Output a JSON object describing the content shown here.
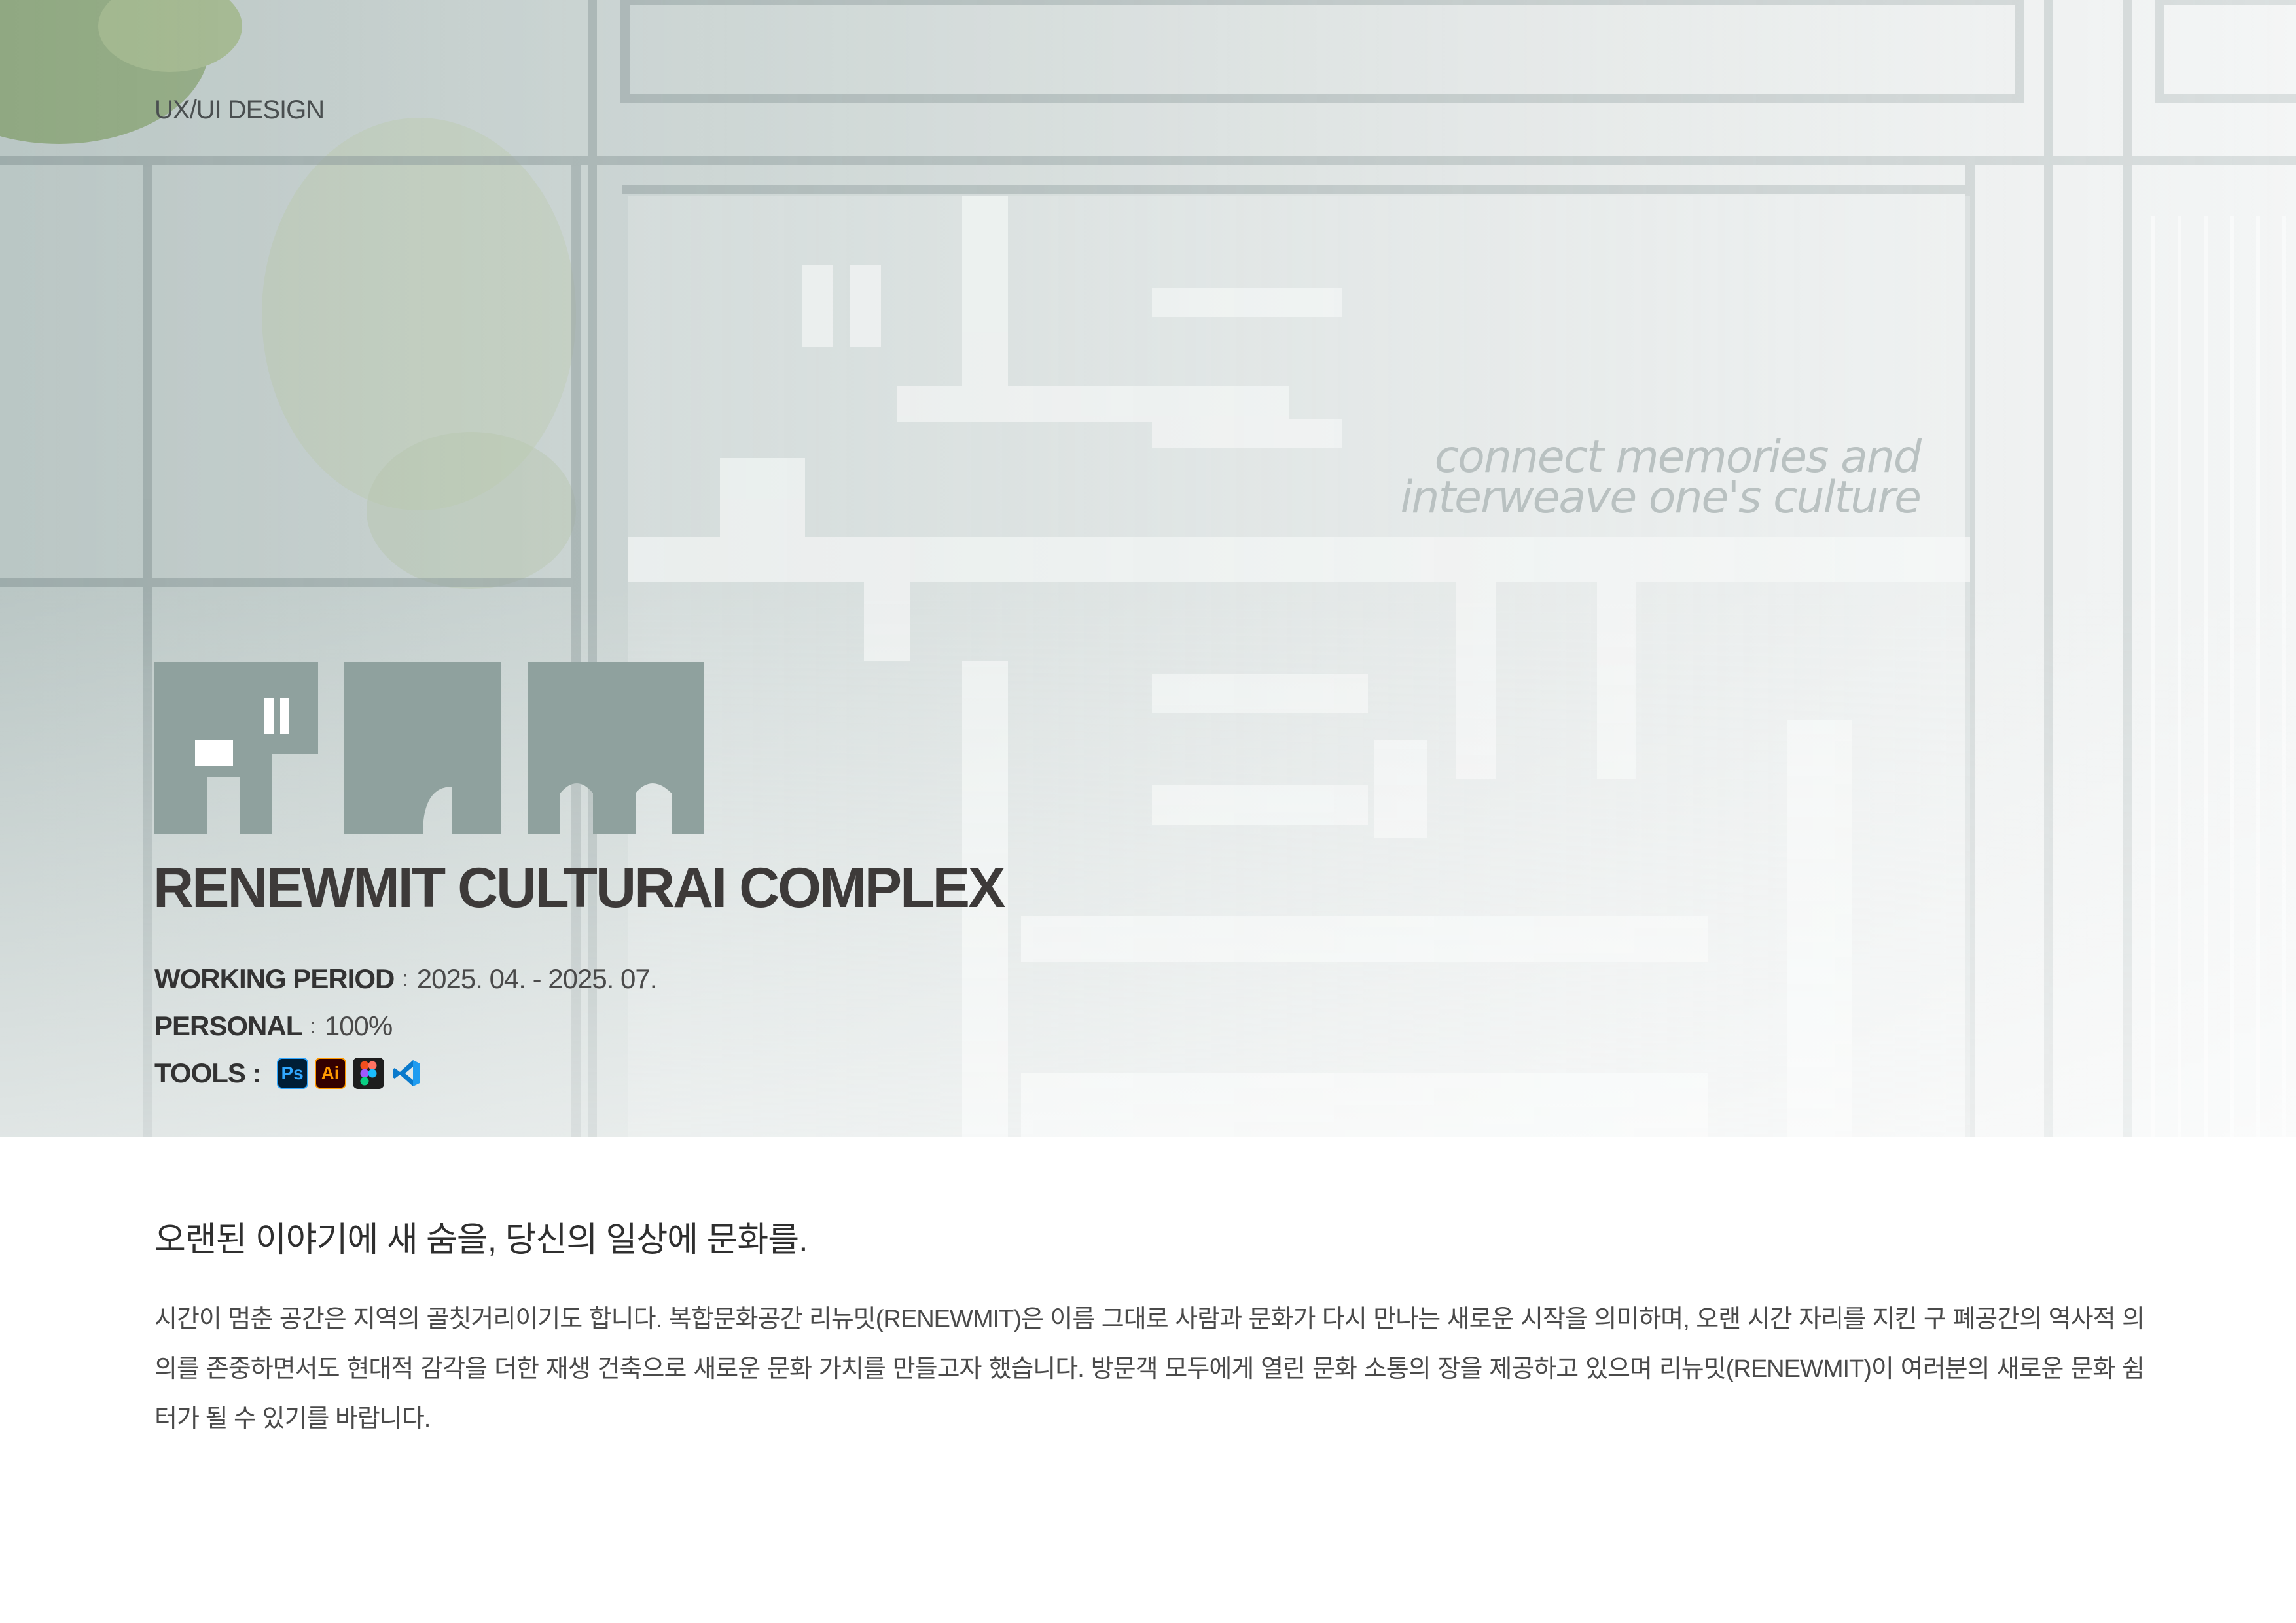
{
  "category": "UX/UI DESIGN",
  "hero": {
    "tagline_line1": "connect memories and",
    "tagline_line2": "interweave one's culture",
    "logo_name": "renewmit-logo"
  },
  "project": {
    "title": "RENEWMIT CULTURAI COMPLEX",
    "meta": {
      "period_label": "WORKING PERIOD",
      "period_value": "2025. 04. - 2025. 07.",
      "personal_label": "PERSONAL",
      "personal_value": "100%",
      "tools_label": "TOOLS :",
      "separator": ":"
    },
    "tools": [
      {
        "name": "Photoshop",
        "label": "Ps",
        "icon": "photoshop-icon"
      },
      {
        "name": "Illustrator",
        "label": "Ai",
        "icon": "illustrator-icon"
      },
      {
        "name": "Figma",
        "label": "",
        "icon": "figma-icon"
      },
      {
        "name": "VS Code",
        "label": "",
        "icon": "vscode-icon"
      }
    ]
  },
  "intro": {
    "headline": "오랜된 이야기에 새 숨을, 당신의 일상에 문화를.",
    "body": "  시간이 멈춘 공간은 지역의 골칫거리이기도 합니다. 복합문화공간 리뉴밋(RENEWMIT)은 이름 그대로 사람과 문화가 다시 만나는 새로운 시작을 의미하며, 오랜 시간 자리를 지킨 구 폐공간의 역사적 의의를 존중하면서도 현대적 감각을 더한 재생 건축으로 새로운 문화 가치를 만들고자 했습니다. 방문객 모두에게 열린 문화 소통의 장을 제공하고 있으며 리뉴밋(RENEWMIT)이 여러분의 새로운 문화 쉼터가 될 수 있기를 바랍니다."
  },
  "colors": {
    "logo": "#8fa19e",
    "title": "#3d3a39",
    "hero_glass": "#b7c4c2"
  }
}
